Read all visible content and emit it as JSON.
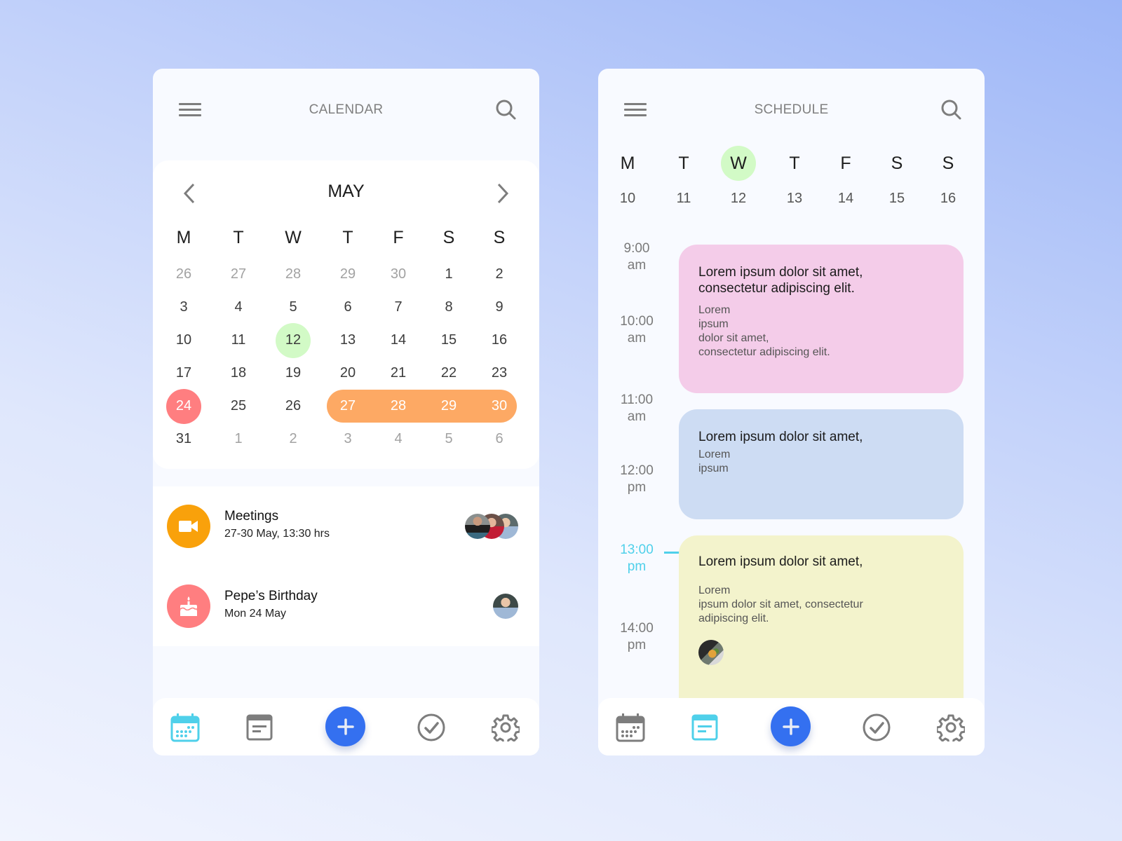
{
  "colors": {
    "accent_blue": "#3470f0",
    "today_green": "#d2fac6",
    "birthday_red": "#ff7e80",
    "range_orange": "#fda964",
    "meeting_orange": "#f9a10b",
    "active_cyan": "#4fd0ea",
    "event_pink": "#f4cce9",
    "event_blue": "#cddcf3",
    "event_yellow": "#f3f3cc"
  },
  "calendar_screen": {
    "title": "CALENDAR",
    "icons": {
      "menu": "hamburger-icon",
      "search": "search-icon",
      "prev": "chevron-left-icon",
      "next": "chevron-right-icon"
    },
    "month": "MAY",
    "weekday_labels": [
      "M",
      "T",
      "W",
      "T",
      "F",
      "S",
      "S"
    ],
    "weeks": [
      [
        {
          "d": "26",
          "muted": true
        },
        {
          "d": "27",
          "muted": true
        },
        {
          "d": "28",
          "muted": true
        },
        {
          "d": "29",
          "muted": true
        },
        {
          "d": "30",
          "muted": true
        },
        {
          "d": "1"
        },
        {
          "d": "2"
        }
      ],
      [
        {
          "d": "3"
        },
        {
          "d": "4"
        },
        {
          "d": "5"
        },
        {
          "d": "6"
        },
        {
          "d": "7"
        },
        {
          "d": "8"
        },
        {
          "d": "9"
        }
      ],
      [
        {
          "d": "10"
        },
        {
          "d": "11"
        },
        {
          "d": "12",
          "state": "today"
        },
        {
          "d": "13"
        },
        {
          "d": "14"
        },
        {
          "d": "15"
        },
        {
          "d": "16"
        }
      ],
      [
        {
          "d": "17"
        },
        {
          "d": "18"
        },
        {
          "d": "19"
        },
        {
          "d": "20"
        },
        {
          "d": "21"
        },
        {
          "d": "22"
        },
        {
          "d": "23"
        }
      ],
      [
        {
          "d": "24",
          "state": "bday"
        },
        {
          "d": "25"
        },
        {
          "d": "26"
        },
        {
          "d": "27",
          "state": "range"
        },
        {
          "d": "28",
          "state": "range"
        },
        {
          "d": "29",
          "state": "range"
        },
        {
          "d": "30",
          "state": "range"
        }
      ],
      [
        {
          "d": "31"
        },
        {
          "d": "1",
          "muted": true
        },
        {
          "d": "2",
          "muted": true
        },
        {
          "d": "3",
          "muted": true
        },
        {
          "d": "4",
          "muted": true
        },
        {
          "d": "5",
          "muted": true
        },
        {
          "d": "6",
          "muted": true
        }
      ]
    ],
    "events": [
      {
        "title": "Meetings",
        "subtitle": "27-30 May, 13:30 hrs",
        "icon": "video-camera-icon",
        "attendees": 3
      },
      {
        "title": "Pepe’s Birthday",
        "subtitle": "Mon 24  May",
        "icon": "birthday-cake-icon",
        "attendees": 1
      }
    ]
  },
  "schedule_screen": {
    "title": "SCHEDULE",
    "week": [
      {
        "l": "M",
        "n": "10"
      },
      {
        "l": "T",
        "n": "11"
      },
      {
        "l": "W",
        "n": "12",
        "active": true
      },
      {
        "l": "T",
        "n": "13"
      },
      {
        "l": "F",
        "n": "14"
      },
      {
        "l": "S",
        "n": "15"
      },
      {
        "l": "S",
        "n": "16"
      }
    ],
    "time_labels": [
      {
        "t": "9:00",
        "p": "am"
      },
      {
        "t": "10:00",
        "p": "am"
      },
      {
        "t": "11:00",
        "p": "am"
      },
      {
        "t": "12:00",
        "p": "pm"
      },
      {
        "t": "13:00",
        "p": "pm",
        "now": true
      },
      {
        "t": "14:00",
        "p": "pm"
      }
    ],
    "events": [
      {
        "title": "Lorem ipsum dolor sit amet,\nconsectetur adipiscing elit.",
        "body": "Lorem\nipsum\ndolor sit amet,\nconsectetur adipiscing elit.",
        "color": "event_pink"
      },
      {
        "title": "Lorem ipsum dolor sit amet,",
        "body": "Lorem\nipsum",
        "color": "event_blue"
      },
      {
        "title": "Lorem ipsum dolor sit amet,",
        "body": "Lorem\nipsum dolor sit amet, consectetur\nadipiscing elit.",
        "color": "event_yellow",
        "has_avatar": true
      }
    ]
  },
  "bottom_nav": {
    "items": [
      "calendar-icon",
      "notes-icon",
      "add-button",
      "check-circle-icon",
      "settings-gear-icon"
    ],
    "calendar_screen_active": "calendar-icon",
    "schedule_screen_active": "notes-icon"
  }
}
